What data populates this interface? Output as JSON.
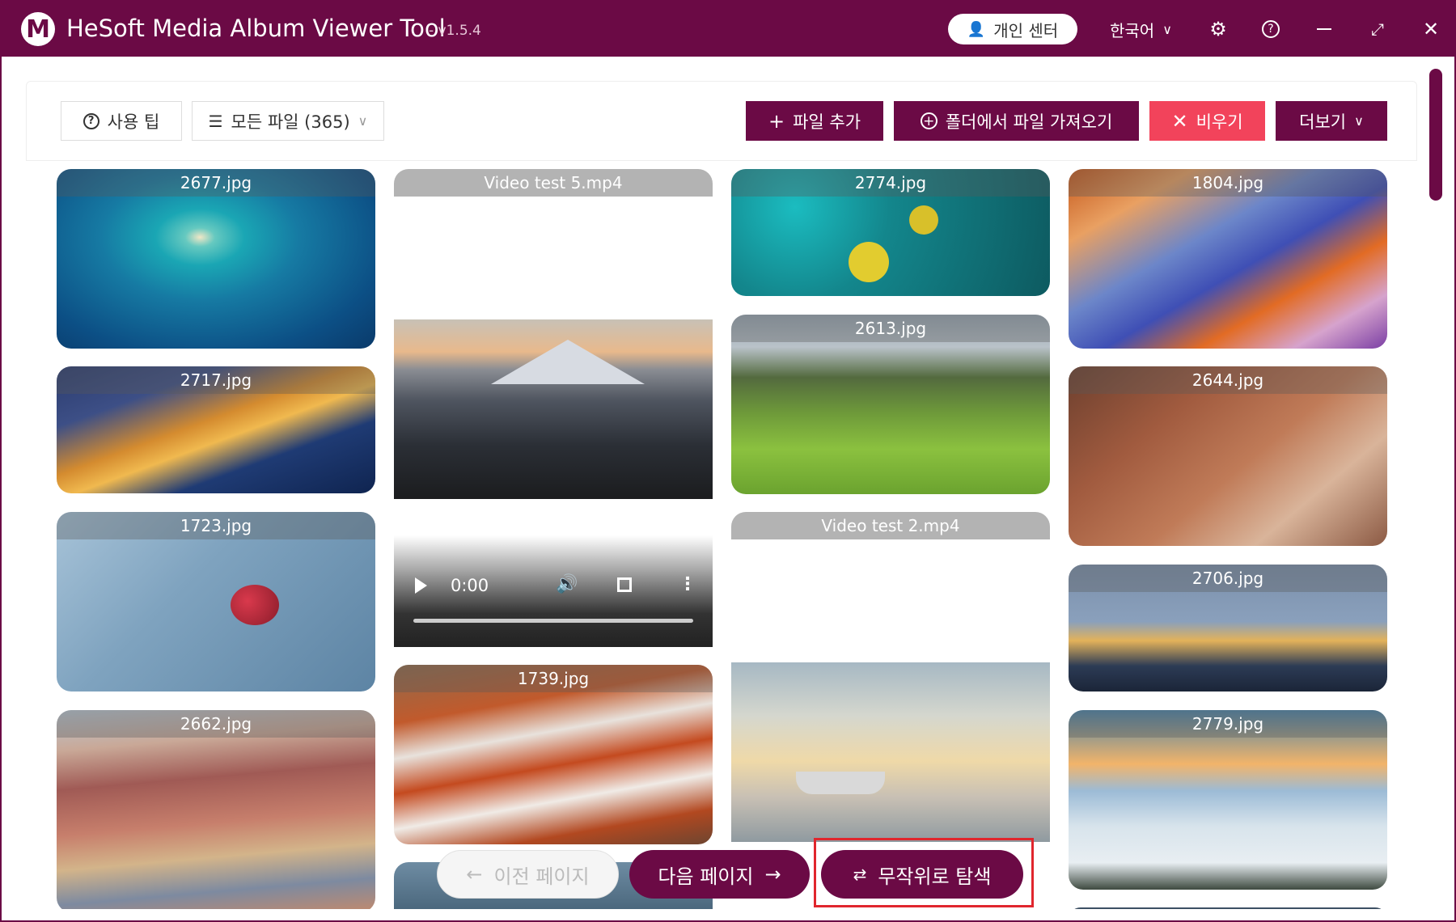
{
  "app": {
    "title": "HeSoft Media Album Viewer Tool",
    "version": "- v1.5.4",
    "logo_letter": "M",
    "user_center": "개인 센터",
    "language": "한국어",
    "accent": "#6b0a45"
  },
  "toolbar": {
    "tips": "사용 팁",
    "filter": "모든 파일 (365)",
    "add_file": "파일 추가",
    "import_folder": "폴더에서 파일 가져오기",
    "clear": "비우기",
    "more": "더보기"
  },
  "gallery": {
    "col1": [
      "2677.jpg",
      "2717.jpg",
      "1723.jpg",
      "2662.jpg"
    ],
    "col2": [
      "Video test 5.mp4",
      "0:00",
      "1739.jpg"
    ],
    "col3": [
      "2774.jpg",
      "2613.jpg",
      "Video test 2.mp4"
    ],
    "col4": [
      "1804.jpg",
      "2644.jpg",
      "2706.jpg",
      "2779.jpg"
    ]
  },
  "nav": {
    "prev": "이전 페이지",
    "next": "다음 페이지",
    "random": "무작위로 탐색"
  }
}
